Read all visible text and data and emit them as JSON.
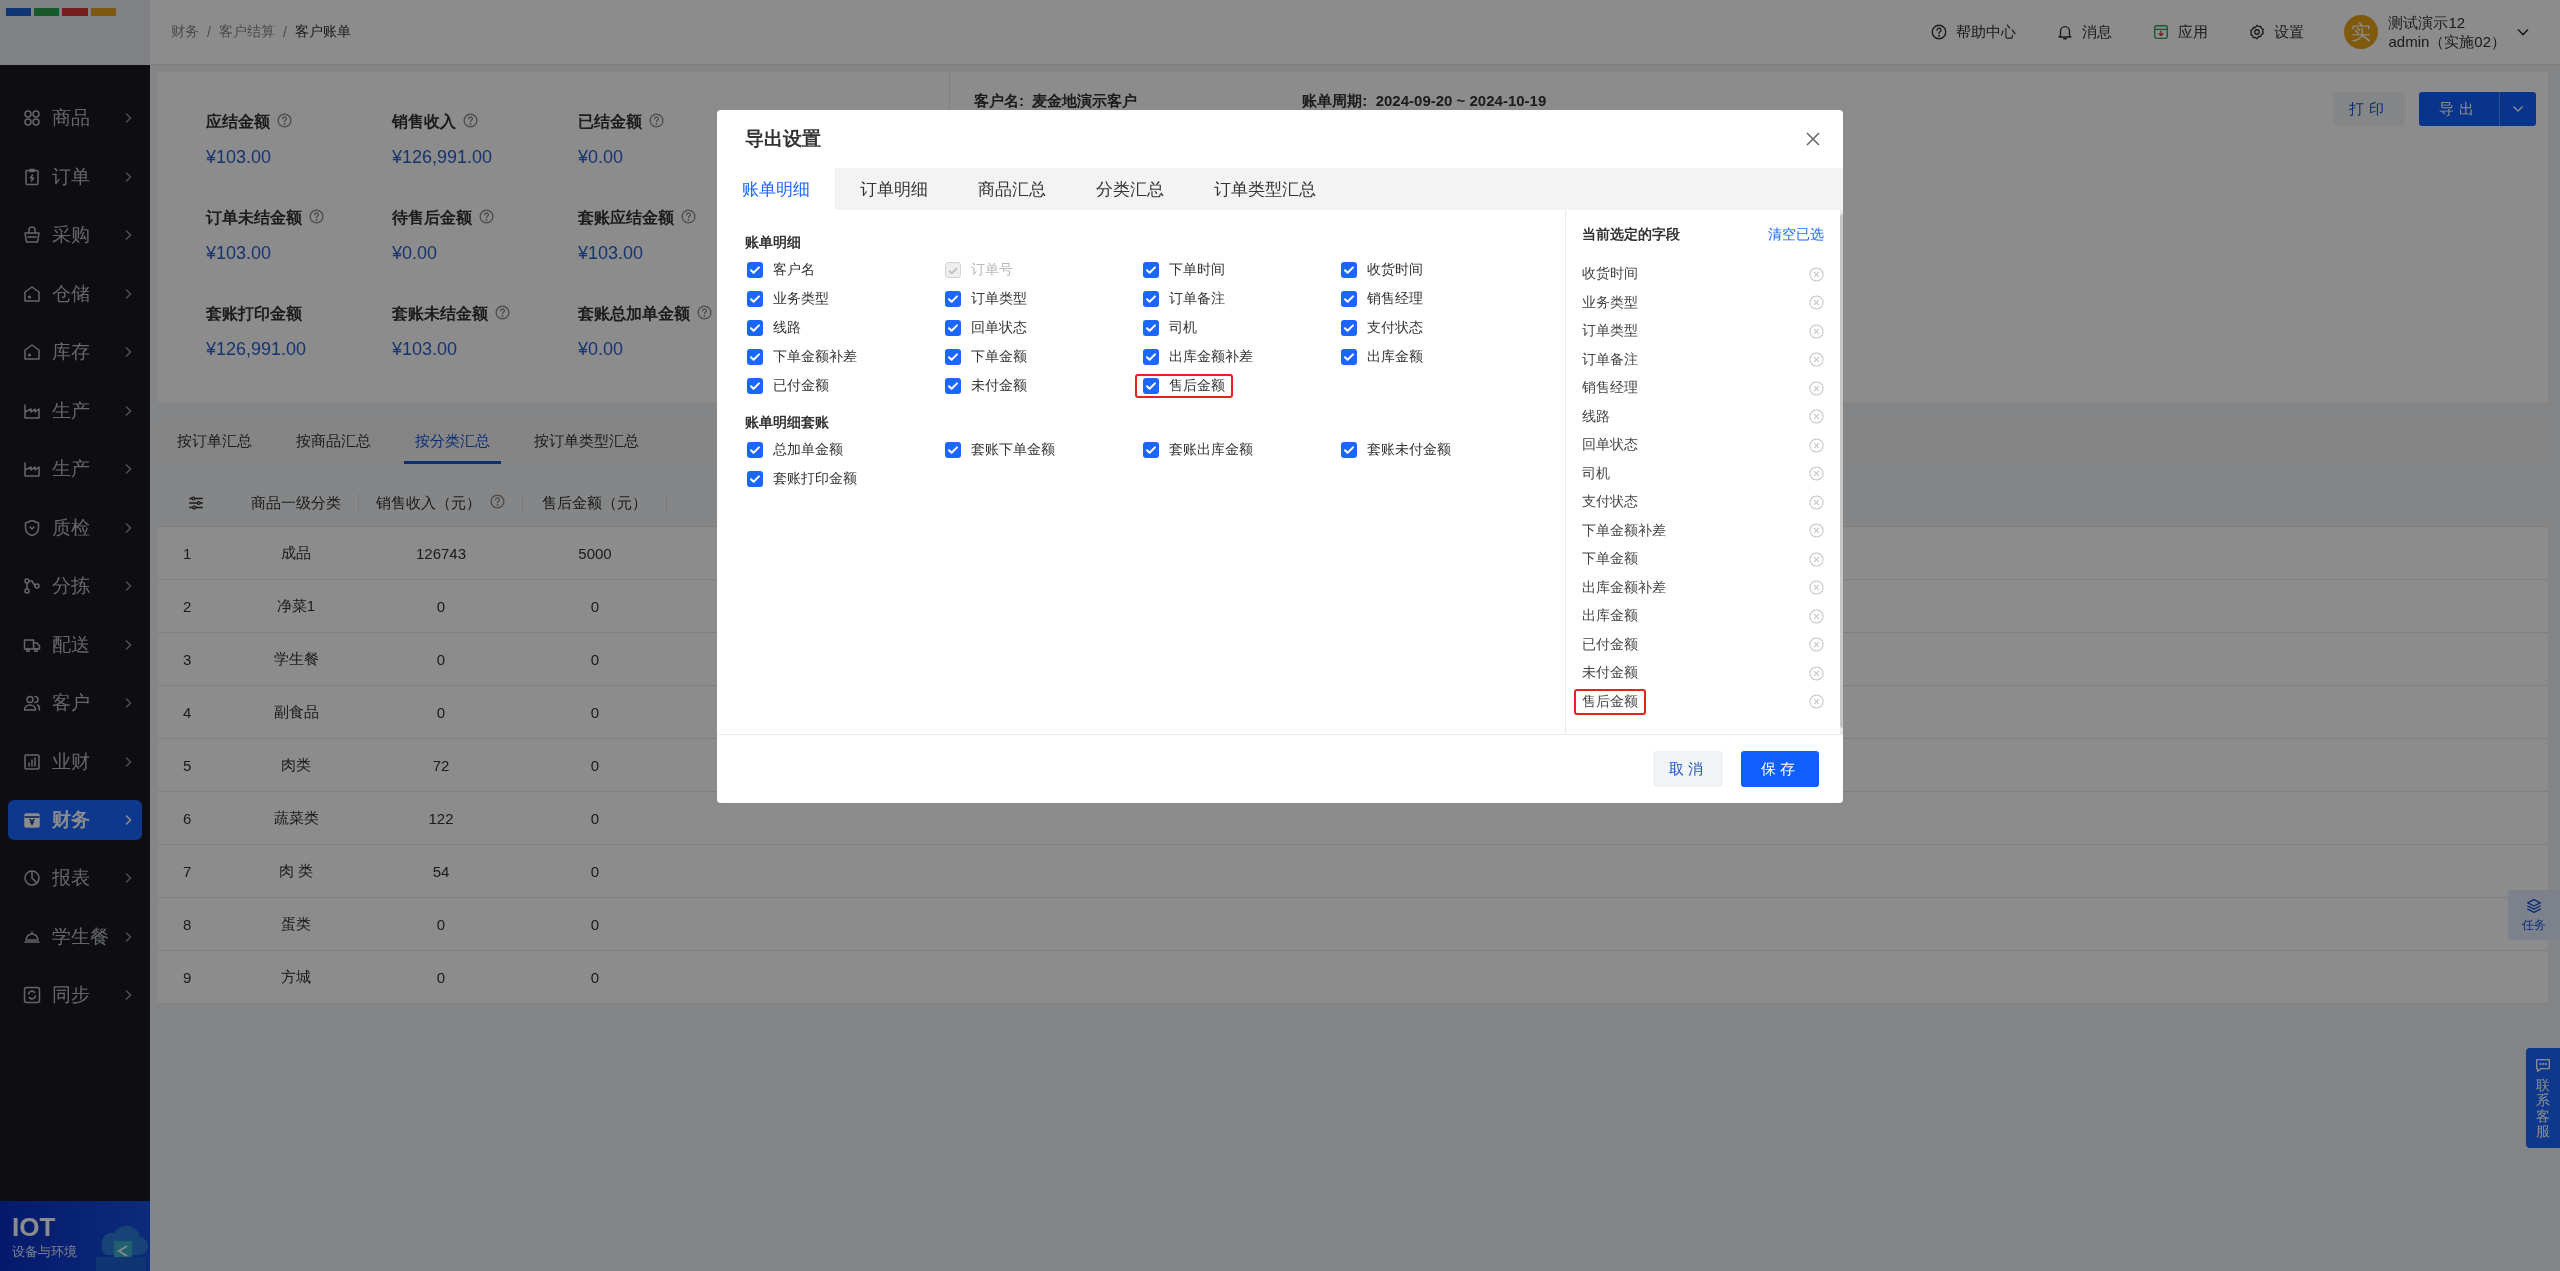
{
  "sidebar": {
    "items": [
      {
        "label": "商品",
        "selected": false
      },
      {
        "label": "订单",
        "selected": false
      },
      {
        "label": "采购",
        "selected": false
      },
      {
        "label": "仓储",
        "selected": false
      },
      {
        "label": "库存",
        "selected": false
      },
      {
        "label": "生产",
        "selected": false
      },
      {
        "label": "生产",
        "selected": false
      },
      {
        "label": "质检",
        "selected": false
      },
      {
        "label": "分拣",
        "selected": false
      },
      {
        "label": "配送",
        "selected": false
      },
      {
        "label": "客户",
        "selected": false
      },
      {
        "label": "业财",
        "selected": false
      },
      {
        "label": "财务",
        "selected": true
      },
      {
        "label": "报表",
        "selected": false
      },
      {
        "label": "学生餐",
        "selected": false
      },
      {
        "label": "同步",
        "selected": false
      }
    ],
    "banner": {
      "title": "IOT",
      "subtitle": "设备与环境"
    }
  },
  "header": {
    "breadcrumb": [
      "财务",
      "客户结算",
      "客户账单"
    ],
    "breadcrumb_separator": "/",
    "tools": [
      "帮助中心",
      "消息",
      "应用",
      "设置"
    ],
    "user": {
      "avatar": "实",
      "name": "测试演示12",
      "role": "admin（实施02）"
    }
  },
  "summary": {
    "stats": [
      {
        "label": "应结金额",
        "value": "¥103.00",
        "help": true
      },
      {
        "label": "销售收入",
        "value": "¥126,991.00",
        "help": true
      },
      {
        "label": "已结金额",
        "value": "¥0.00",
        "help": true
      },
      {
        "label": "订单未结金额",
        "value": "¥103.00",
        "help": true
      },
      {
        "label": "待售后金额",
        "value": "¥0.00",
        "help": true
      },
      {
        "label": "套账应结金额",
        "value": "¥103.00",
        "help": true
      },
      {
        "label": "套账打印金额",
        "value": "¥126,991.00",
        "help": false
      },
      {
        "label": "套账未结金额",
        "value": "¥103.00",
        "help": true
      },
      {
        "label": "套账总加单金额",
        "value": "¥0.00",
        "help": true
      }
    ]
  },
  "bill_info": {
    "customer_label": "客户名:",
    "customer": "麦金地演示客户",
    "period_label": "账单周期:",
    "period": "2024-09-20 ~ 2024-10-19"
  },
  "actions": {
    "print": "打印",
    "export": "导出"
  },
  "summary_tabs": [
    {
      "label": "按订单汇总",
      "selected": false
    },
    {
      "label": "按商品汇总",
      "selected": false
    },
    {
      "label": "按分类汇总",
      "selected": true
    },
    {
      "label": "按订单类型汇总",
      "selected": false
    }
  ],
  "table": {
    "columns": [
      {
        "label": "商品一级分类",
        "help": false
      },
      {
        "label": "销售收入（元）",
        "help": true
      },
      {
        "label": "售后金额（元）",
        "help": false
      }
    ],
    "rows": [
      {
        "number": "1",
        "cells": [
          "成品",
          "126743",
          "5000"
        ]
      },
      {
        "number": "2",
        "cells": [
          "净菜1",
          "0",
          "0"
        ]
      },
      {
        "number": "3",
        "cells": [
          "学生餐",
          "0",
          "0"
        ]
      },
      {
        "number": "4",
        "cells": [
          "副食品",
          "0",
          "0"
        ]
      },
      {
        "number": "5",
        "cells": [
          "肉类",
          "72",
          "0"
        ]
      },
      {
        "number": "6",
        "cells": [
          "蔬菜类",
          "122",
          "0"
        ]
      },
      {
        "number": "7",
        "cells": [
          "肉 类",
          "54",
          "0"
        ]
      },
      {
        "number": "8",
        "cells": [
          "蛋类",
          "0",
          "0"
        ]
      },
      {
        "number": "9",
        "cells": [
          "方城",
          "0",
          "0"
        ]
      }
    ]
  },
  "float_buttons": [
    {
      "kind": "task",
      "label": "任务"
    },
    {
      "kind": "service",
      "label": "联系客服"
    }
  ],
  "dialog": {
    "title": "导出设置",
    "tabs": [
      {
        "label": "账单明细",
        "selected": true
      },
      {
        "label": "订单明细",
        "selected": false
      },
      {
        "label": "商品汇总",
        "selected": false
      },
      {
        "label": "分类汇总",
        "selected": false
      },
      {
        "label": "订单类型汇总",
        "selected": false
      }
    ],
    "sections": [
      {
        "title": "账单明细",
        "fields": [
          {
            "label": "客户名",
            "checked": true,
            "disabled": false,
            "highlighted": false
          },
          {
            "label": "订单号",
            "checked": true,
            "disabled": true,
            "highlighted": false
          },
          {
            "label": "下单时间",
            "checked": true,
            "disabled": false,
            "highlighted": false
          },
          {
            "label": "收货时间",
            "checked": true,
            "disabled": false,
            "highlighted": false
          },
          {
            "label": "业务类型",
            "checked": true,
            "disabled": false,
            "highlighted": false
          },
          {
            "label": "订单类型",
            "checked": true,
            "disabled": false,
            "highlighted": false
          },
          {
            "label": "订单备注",
            "checked": true,
            "disabled": false,
            "highlighted": false
          },
          {
            "label": "销售经理",
            "checked": true,
            "disabled": false,
            "highlighted": false
          },
          {
            "label": "线路",
            "checked": true,
            "disabled": false,
            "highlighted": false
          },
          {
            "label": "回单状态",
            "checked": true,
            "disabled": false,
            "highlighted": false
          },
          {
            "label": "司机",
            "checked": true,
            "disabled": false,
            "highlighted": false
          },
          {
            "label": "支付状态",
            "checked": true,
            "disabled": false,
            "highlighted": false
          },
          {
            "label": "下单金额补差",
            "checked": true,
            "disabled": false,
            "highlighted": false
          },
          {
            "label": "下单金额",
            "checked": true,
            "disabled": false,
            "highlighted": false
          },
          {
            "label": "出库金额补差",
            "checked": true,
            "disabled": false,
            "highlighted": false
          },
          {
            "label": "出库金额",
            "checked": true,
            "disabled": false,
            "highlighted": false
          },
          {
            "label": "已付金额",
            "checked": true,
            "disabled": false,
            "highlighted": false
          },
          {
            "label": "未付金额",
            "checked": true,
            "disabled": false,
            "highlighted": false
          },
          {
            "label": "售后金额",
            "checked": true,
            "disabled": false,
            "highlighted": true
          }
        ]
      },
      {
        "title": "账单明细套账",
        "fields": [
          {
            "label": "总加单金额",
            "checked": true,
            "disabled": false,
            "highlighted": false
          },
          {
            "label": "套账下单金额",
            "checked": true,
            "disabled": false,
            "highlighted": false
          },
          {
            "label": "套账出库金额",
            "checked": true,
            "disabled": false,
            "highlighted": false
          },
          {
            "label": "套账未付金额",
            "checked": true,
            "disabled": false,
            "highlighted": false
          },
          {
            "label": "套账打印金额",
            "checked": true,
            "disabled": false,
            "highlighted": false
          }
        ]
      }
    ],
    "selected_panel": {
      "title": "当前选定的字段",
      "clear": "清空已选",
      "items": [
        {
          "label": "收货时间",
          "highlighted": false
        },
        {
          "label": "业务类型",
          "highlighted": false
        },
        {
          "label": "订单类型",
          "highlighted": false
        },
        {
          "label": "订单备注",
          "highlighted": false
        },
        {
          "label": "销售经理",
          "highlighted": false
        },
        {
          "label": "线路",
          "highlighted": false
        },
        {
          "label": "回单状态",
          "highlighted": false
        },
        {
          "label": "司机",
          "highlighted": false
        },
        {
          "label": "支付状态",
          "highlighted": false
        },
        {
          "label": "下单金额补差",
          "highlighted": false
        },
        {
          "label": "下单金额",
          "highlighted": false
        },
        {
          "label": "出库金额补差",
          "highlighted": false
        },
        {
          "label": "出库金额",
          "highlighted": false
        },
        {
          "label": "已付金额",
          "highlighted": false
        },
        {
          "label": "未付金额",
          "highlighted": false
        },
        {
          "label": "售后金额",
          "highlighted": true
        }
      ]
    },
    "buttons": [
      {
        "kind": "secondary",
        "label": "取消"
      },
      {
        "kind": "primary",
        "label": "保存"
      }
    ]
  }
}
